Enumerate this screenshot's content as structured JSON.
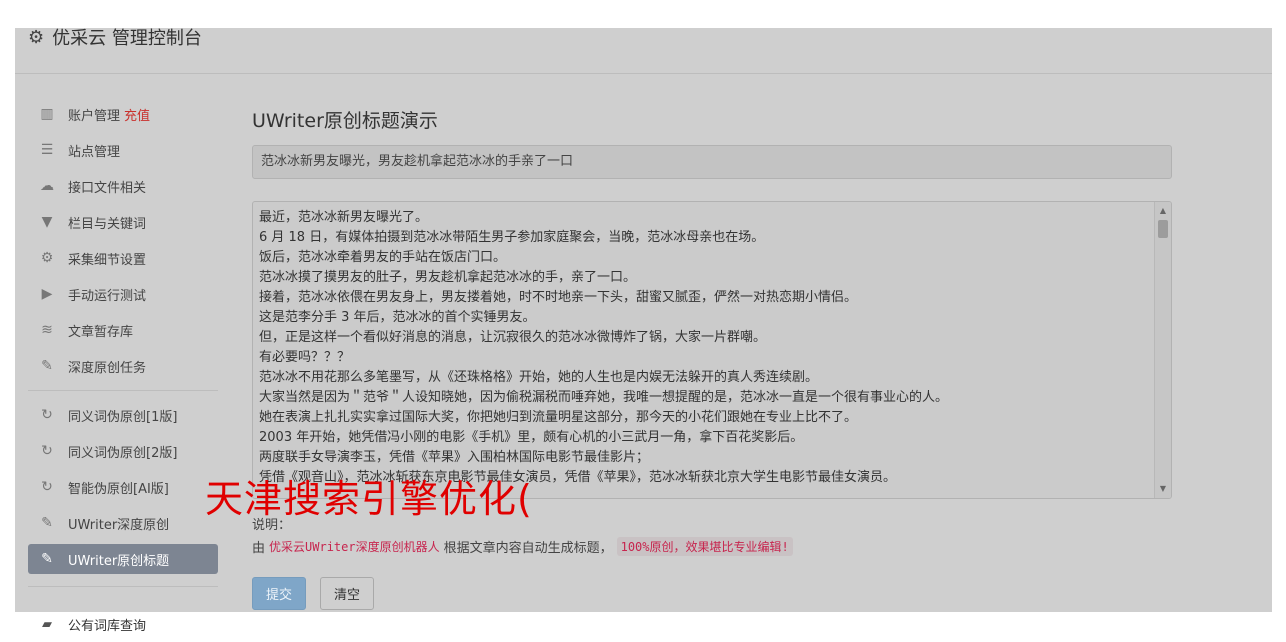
{
  "header": {
    "title": "优采云 管理控制台",
    "icon": "gear-icon"
  },
  "sidebar": {
    "group1": [
      {
        "label": "账户管理",
        "badge": "充值",
        "icon": "bar-chart-icon",
        "glyph": "▥"
      },
      {
        "label": "站点管理",
        "icon": "server-icon",
        "glyph": "☰"
      },
      {
        "label": "接口文件相关",
        "icon": "cloud-upload-icon",
        "glyph": "☁"
      },
      {
        "label": "栏目与关键词",
        "icon": "filter-icon",
        "glyph": "▼"
      },
      {
        "label": "采集细节设置",
        "icon": "cogs-icon",
        "glyph": "⚙"
      },
      {
        "label": "手动运行测试",
        "icon": "play-circle-icon",
        "glyph": "▶"
      },
      {
        "label": "文章暂存库",
        "icon": "database-icon",
        "glyph": "≋"
      },
      {
        "label": "深度原创任务",
        "icon": "edit-icon",
        "glyph": "✎"
      }
    ],
    "group2": [
      {
        "label": "同义词伪原创[1版]",
        "icon": "refresh-icon",
        "glyph": "↻"
      },
      {
        "label": "同义词伪原创[2版]",
        "icon": "refresh-icon",
        "glyph": "↻"
      },
      {
        "label": "智能伪原创[AI版]",
        "icon": "refresh-icon",
        "glyph": "↻"
      },
      {
        "label": "UWriter深度原创",
        "icon": "edit-icon",
        "glyph": "✎"
      },
      {
        "label": "UWriter原创标题",
        "icon": "edit-icon",
        "glyph": "✎",
        "active": true
      }
    ],
    "outside": {
      "label": "公有词库查询",
      "icon": "book-icon",
      "glyph": "▰"
    }
  },
  "main": {
    "title": "UWriter原创标题演示",
    "title_input": "范冰冰新男友曝光，男友趁机拿起范冰冰的手亲了一口",
    "content_lines": [
      "最近，范冰冰新男友曝光了。",
      "6 月 18 日，有媒体拍摄到范冰冰带陌生男子参加家庭聚会，当晚，范冰冰母亲也在场。",
      "饭后，范冰冰牵着男友的手站在饭店门口。",
      "范冰冰摸了摸男友的肚子，男友趁机拿起范冰冰的手，亲了一口。",
      "接着，范冰冰依偎在男友身上，男友搂着她，时不时地亲一下头，甜蜜又腻歪，俨然一对热恋期小情侣。",
      "这是范李分手 3 年后，范冰冰的首个实锤男友。",
      "但，正是这样一个看似好消息的消息，让沉寂很久的范冰冰微博炸了锅，大家一片群嘲。",
      "有必要吗？？？",
      "范冰冰不用花那么多笔墨写，从《还珠格格》开始，她的人生也是内娱无法躲开的真人秀连续剧。",
      "大家当然是因为＂范爷＂人设知晓她，因为偷税漏税而唾弃她，我唯一想提醒的是，范冰冰一直是一个很有事业心的人。",
      "她在表演上扎扎实实拿过国际大奖，你把她归到流量明星这部分，那今天的小花们跟她在专业上比不了。",
      "2003 年开始，她凭借冯小刚的电影《手机》里，颇有心机的小三武月一角，拿下百花奖影后。",
      "两度联手女导演李玉，凭借《苹果》入围柏林国际电影节最佳影片；",
      "凭借《观音山》，范冰冰斩获东京电影节最佳女演员，凭借《苹果》，范冰冰斩获北京大学生电影节最佳女演员。"
    ],
    "note_label": "说明：",
    "note_prefix": "由",
    "note_link": "优采云UWriter深度原创机器人",
    "note_middle": "根据文章内容自动生成标题，",
    "note_highlight": "100%原创，效果堪比专业编辑!",
    "submit_label": "提交",
    "clear_label": "清空"
  },
  "watermark": "天津搜索引擎优化("
}
